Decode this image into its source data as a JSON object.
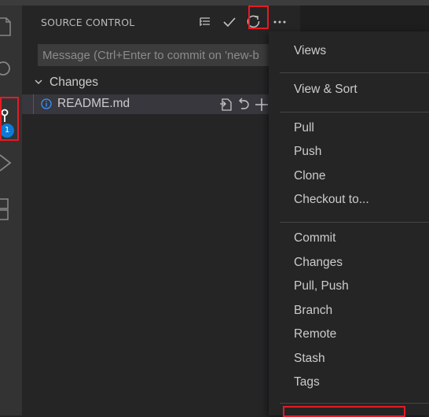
{
  "sidebar": {
    "title": "SOURCE CONTROL",
    "commit_placeholder": "Message (Ctrl+Enter to commit on 'new-b",
    "changes_label": "Changes",
    "files": [
      {
        "name": "README.md"
      }
    ],
    "badge_count": "1"
  },
  "menu": {
    "items": [
      "Views",
      "View & Sort",
      "Pull",
      "Push",
      "Clone",
      "Checkout to...",
      "Commit",
      "Changes",
      "Pull, Push",
      "Branch",
      "Remote",
      "Stash",
      "Tags"
    ]
  },
  "colors": {
    "highlight": "#e51b23",
    "badge": "#0e7ad3"
  }
}
